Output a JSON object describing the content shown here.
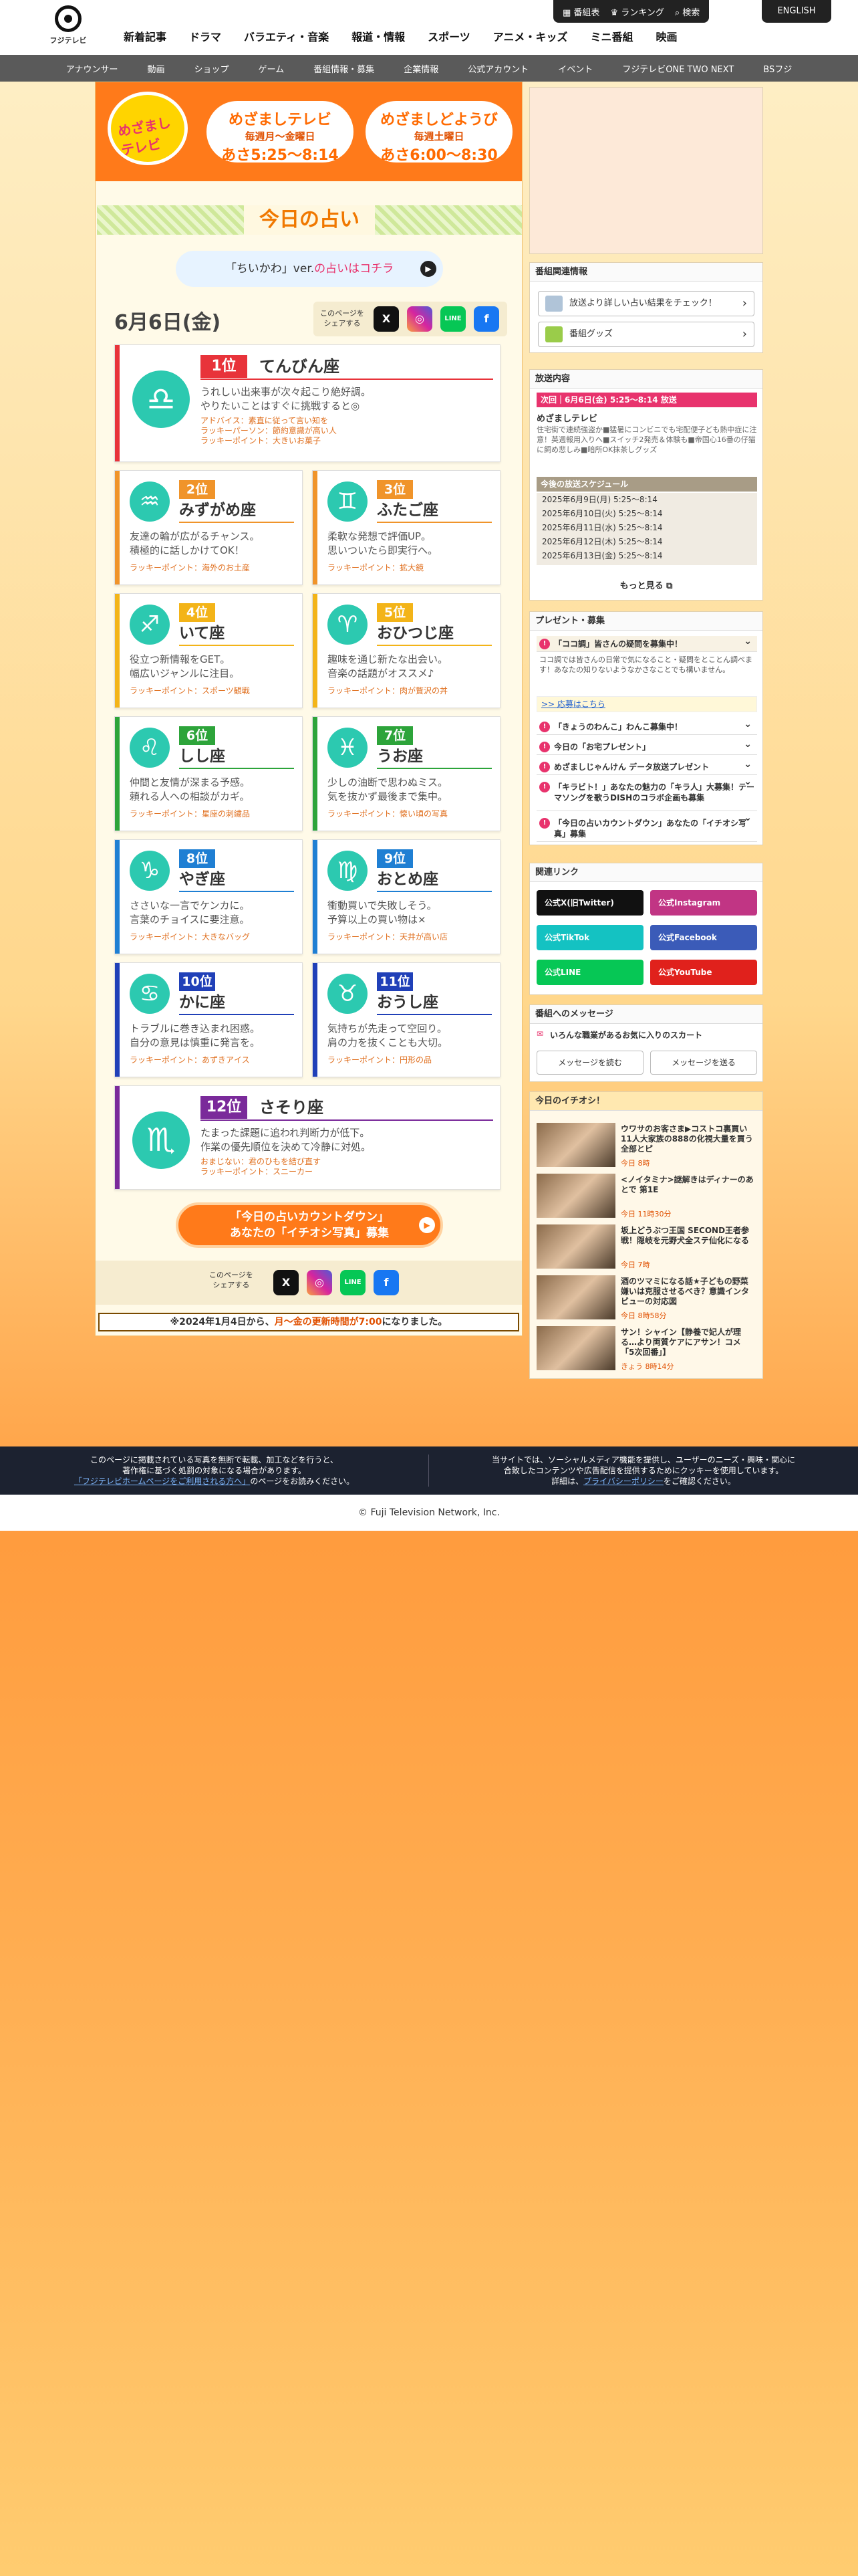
{
  "header": {
    "logo_text": "フジテレビ",
    "nav": [
      "新着記事",
      "ドラマ",
      "バラエティ・音楽",
      "報道・情報",
      "スポーツ",
      "アニメ・キッズ",
      "ミニ番組",
      "映画"
    ],
    "util": [
      "番組表",
      "ランキング",
      "検索"
    ],
    "english": "ENGLISH"
  },
  "subnav": [
    "アナウンサー",
    "動画",
    "ショップ",
    "ゲーム",
    "番組情報・募集",
    "企業情報",
    "公式アカウント",
    "イベント",
    "フジテレビONE TWO NEXT",
    "BSフジ"
  ],
  "banner": {
    "logo": "めざましテレビ",
    "left": {
      "name": "めざましテレビ",
      "days": "毎週月～金曜日",
      "time": "あさ5:25～8:14"
    },
    "right": {
      "name": "めざましどようび",
      "days": "毎週土曜日",
      "time": "あさ6:00～8:30"
    }
  },
  "title": "今日の占い",
  "chiikawa": {
    "pre": "「ちいかわ」ver.",
    "link": "の占いはコチラ"
  },
  "date": "6月6日(金)",
  "share_label": "このページを\nシェアする",
  "share": {
    "x": "X",
    "line": "LINE",
    "facebook": "f",
    "instagram": "◎"
  },
  "ranks": [
    {
      "rank": "1位",
      "name": "てんびん座",
      "symbol": "♎",
      "color": "#e8333a",
      "text": [
        "うれしい出来事が次々起こり絶好調。",
        "やりたいことはすぐに挑戦すると◎"
      ],
      "lucky": [
        "アドバイス：素直に従って言い知を",
        "ラッキーパーソン：節約意識が高い人",
        "ラッキーポイント：大きいお菓子"
      ]
    },
    {
      "rank": "2位",
      "name": "みずがめ座",
      "symbol": "♒",
      "color": "#f0942a",
      "text": [
        "友達の輪が広がるチャンス。",
        "積極的に話しかけてOK！"
      ],
      "lucky": "ラッキーポイント：海外のお土産"
    },
    {
      "rank": "3位",
      "name": "ふたご座",
      "symbol": "♊",
      "color": "#f0942a",
      "text": [
        "柔軟な発想で評価UP。",
        "思いついたら即実行へ。"
      ],
      "lucky": "ラッキーポイント：拡大鏡"
    },
    {
      "rank": "4位",
      "name": "いて座",
      "symbol": "♐",
      "color": "#f3b418",
      "text": [
        "役立つ新情報をGET。",
        "幅広いジャンルに注目。"
      ],
      "lucky": "ラッキーポイント：スポーツ観戦"
    },
    {
      "rank": "5位",
      "name": "おひつじ座",
      "symbol": "♈",
      "color": "#f3b418",
      "text": [
        "趣味を通じ新たな出会い。",
        "音楽の話題がオススメ♪"
      ],
      "lucky": "ラッキーポイント：肉が贅沢の丼"
    },
    {
      "rank": "6位",
      "name": "しし座",
      "symbol": "♌",
      "color": "#2da43a",
      "text": [
        "仲間と友情が深まる予感。",
        "頼れる人への相談がカギ。"
      ],
      "lucky": "ラッキーポイント：星座の刺繍品"
    },
    {
      "rank": "7位",
      "name": "うお座",
      "symbol": "♓",
      "color": "#2da43a",
      "text": [
        "少しの油断で思わぬミス。",
        "気を抜かず最後まで集中。"
      ],
      "lucky": "ラッキーポイント：懐い頃の写真"
    },
    {
      "rank": "8位",
      "name": "やぎ座",
      "symbol": "♑",
      "color": "#1f7fd3",
      "text": [
        "ささいな一言でケンカに。",
        "言葉のチョイスに要注意。"
      ],
      "lucky": "ラッキーポイント：大きなバッグ"
    },
    {
      "rank": "9位",
      "name": "おとめ座",
      "symbol": "♍",
      "color": "#1f7fd3",
      "text": [
        "衝動買いで失敗しそう。",
        "予算以上の買い物は×"
      ],
      "lucky": "ラッキーポイント：天井が高い店"
    },
    {
      "rank": "10位",
      "name": "かに座",
      "symbol": "♋",
      "color": "#2040b8",
      "text": [
        "トラブルに巻き込まれ困惑。",
        "自分の意見は慎重に発言を。"
      ],
      "lucky": "ラッキーポイント：あずきアイス"
    },
    {
      "rank": "11位",
      "name": "おうし座",
      "symbol": "♉",
      "color": "#2040b8",
      "text": [
        "気持ちが先走って空回り。",
        "肩の力を抜くことも大切。"
      ],
      "lucky": "ラッキーポイント：円形の品"
    },
    {
      "rank": "12位",
      "name": "さそり座",
      "symbol": "♏",
      "color": "#7a2a9a",
      "text": [
        "たまった課題に追われ判断力が低下。",
        "作業の優先順位を決めて冷静に対処。"
      ],
      "lucky": [
        "おまじない：君のひもを結び直す",
        "ラッキーポイント：スニーカー"
      ]
    }
  ],
  "countdown": {
    "line1": "「今日の占いカウントダウン」",
    "line2": "あなたの「イチオシ写真」募集"
  },
  "notice": {
    "pre": "※2024年1月4日から、",
    "em": "月～金の更新時間が7:00",
    "post": "になりました。"
  },
  "side": {
    "related_title": "番組関連情報",
    "related": [
      "放送より詳しい占い結果をチェック！",
      "番組グッズ"
    ],
    "onair_title": "放送内容",
    "next": "次回｜6月6日(金) 5:25～8:14 放送",
    "program": "めざましテレビ",
    "desc": "住宅街で連続強盗か■猛暑にコンビニでも宅配便子ども熱中症に注意！英週報用入りへ■スイッチ2発売＆体験も■帝国心16番の仔猫に飼め悲しみ■暗所OK抹茶しグッズ",
    "schedule_title": "今後の放送スケジュール",
    "schedule": [
      "2025年6月9日(月) 5:25～8:14",
      "2025年6月10日(火) 5:25～8:14",
      "2025年6月11日(水) 5:25～8:14",
      "2025年6月12日(木) 5:25～8:14",
      "2025年6月13日(金) 5:25～8:14"
    ],
    "more": "もっと見る",
    "present_title": "プレゼント・募集",
    "open_item": "「ココ調」皆さんの疑問を募集中！",
    "open_desc": "ココ調では皆さんの日常で気になること・疑問をとことん調べます！あなたの知りないようなかさなことでも構いません。",
    "open_link": ">> 応募はこちら",
    "present_items": [
      "「きょうのわんこ」わんこ募集中！",
      "今日の「お宅プレゼント」",
      "めざましじゃんけん データ放送プレゼント",
      "「キラビト！」あなたの魅力の「キラ人」大募集！テーマソングを歌うDISHのコラボ企画も募集",
      "「今日の占いカウントダウン」あなたの「イチオシ写真」募集"
    ],
    "links_title": "関連リンク",
    "links": [
      {
        "label": "公式X(旧Twitter)",
        "color": "#111"
      },
      {
        "label": "公式Instagram",
        "color": "#c13584"
      },
      {
        "label": "公式TikTok",
        "color": "#14c2c2"
      },
      {
        "label": "公式Facebook",
        "color": "#3b5bb8"
      },
      {
        "label": "公式LINE",
        "color": "#06c755"
      },
      {
        "label": "公式YouTube",
        "color": "#e0211c"
      }
    ],
    "message_title": "番組へのメッセージ",
    "message_item": "いろんな職業があるお気に入りのスカート",
    "message_read": "メッセージを読む",
    "message_send": "メッセージを送る",
    "pick_title": "今日のイチオシ！",
    "picks": [
      {
        "t": "ウワサのお客さま▶コストコ裏買い11人大家族の888の化視大量を買う全部とピ",
        "d": "今日 8時"
      },
      {
        "t": "<ノイタミナ>謎解きはディナーのあとで 第1E",
        "d": "今日 11時30分"
      },
      {
        "t": "坂上どうぶつ王国 SECOND王者参戦！隠岐を元野犬全ステ仙化になる",
        "d": "今日 7時"
      },
      {
        "t": "酒のツマミになる話★子どもの野菜嫌いは克服させるべき？意識インタビューの対応図",
        "d": "今日 8時58分"
      },
      {
        "t": "サン！シャイン【静養で妃人が理る…より両質ケアにアサン！コメ「5次回番」】",
        "d": "きょう 8時14分"
      }
    ]
  },
  "footer": {
    "left1": "このページに掲載されている写真を無断で転載、加工などを行うと、",
    "left2": "著作権に基づく処罰の対象になる場合があります。",
    "left3_link": "「フジテレビホームページをご利用される方へ」",
    "left3": "のページをお読みください。",
    "right1": "当サイトでは、ソーシャルメディア機能を提供し、ユーザーのニーズ・興味・関心に",
    "right2": "合致したコンテンツや広告配信を提供するためにクッキーを使用しています。",
    "right3_pre": "詳細は、",
    "right3_link": "プライバシーポリシー",
    "right3_post": "をご確認ください。",
    "copyright": "© Fuji Television Network, Inc."
  }
}
